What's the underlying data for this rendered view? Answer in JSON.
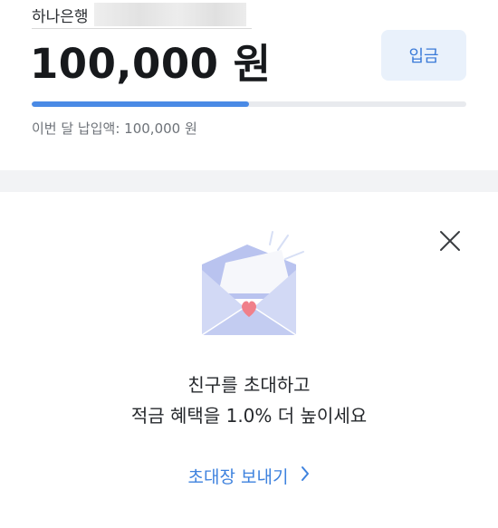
{
  "account": {
    "bank_name": "하나은행",
    "balance": "100,000 원",
    "deposit_label": "입금",
    "progress_fraction": 0.5,
    "monthly_label": "이번 달 납입액:",
    "monthly_value": "100,000 원"
  },
  "invite": {
    "line1": "친구를 초대하고",
    "line2": "적금 혜택을 1.0% 더 높이세요",
    "link_label": "초대장 보내기",
    "icons": [
      "close-icon",
      "envelope-heart-icon",
      "chevron-right-icon"
    ]
  },
  "colors": {
    "accent": "#4a8ae5",
    "link": "#3e82de",
    "deposit_bg": "#e9f1fb",
    "divider": "#f2f3f5"
  }
}
